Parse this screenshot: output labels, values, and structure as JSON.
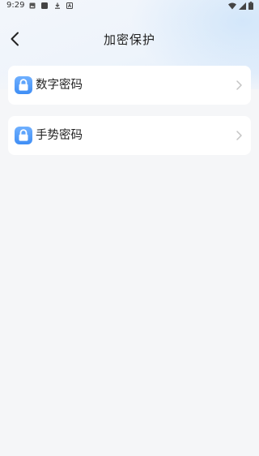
{
  "status_bar": {
    "time": "9:29",
    "left_icons": [
      "image-icon",
      "app-square-icon",
      "download-icon",
      "font-a-icon"
    ],
    "right_icons": [
      "wifi-icon",
      "signal-icon",
      "battery-icon"
    ]
  },
  "nav": {
    "title": "加密保护",
    "back_icon": "chevron-left-icon"
  },
  "options": [
    {
      "label": "数字密码",
      "icon": "lock-icon"
    },
    {
      "label": "手势密码",
      "icon": "lock-icon"
    }
  ],
  "colors": {
    "accent": "#3f8ef5",
    "background": "#f5f6f8",
    "card": "#ffffff",
    "chevron": "#c4c4c4"
  }
}
